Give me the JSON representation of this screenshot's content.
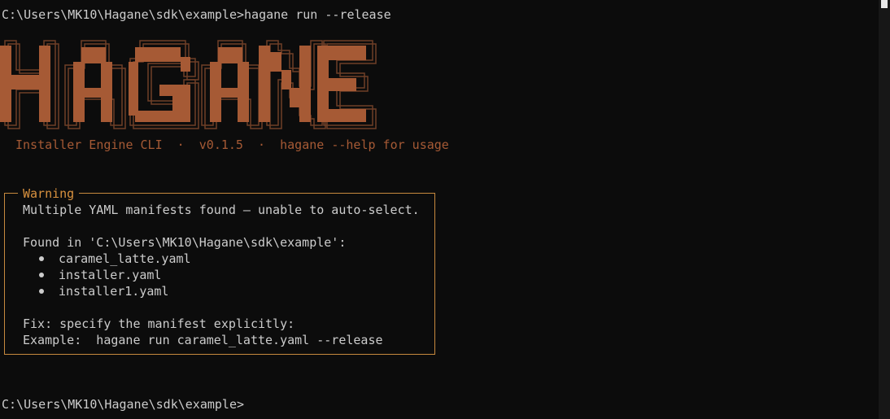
{
  "terminal": {
    "command_line": "C:\\Users\\MK10\\Hagane\\sdk\\example>hagane run --release",
    "prompt_line": "C:\\Users\\MK10\\Hagane\\sdk\\example>"
  },
  "banner": {
    "logo_text": "HAGANE",
    "subtitle": "Installer Engine CLI  ·  v0.1.5  ·  hagane --help for usage",
    "colors": {
      "fill": "#a65a35",
      "outline": "#6e3e27"
    }
  },
  "warning": {
    "title": "Warning",
    "message": "Multiple YAML manifests found — unable to auto-select.",
    "found_in": "Found in 'C:\\Users\\MK10\\Hagane\\sdk\\example':",
    "files": [
      "caramel_latte.yaml",
      "installer.yaml",
      "installer1.yaml"
    ],
    "fix": "Fix: specify the manifest explicitly:",
    "example": "Example:  hagane run caramel_latte.yaml --release",
    "border_color": "#c78a3e"
  }
}
